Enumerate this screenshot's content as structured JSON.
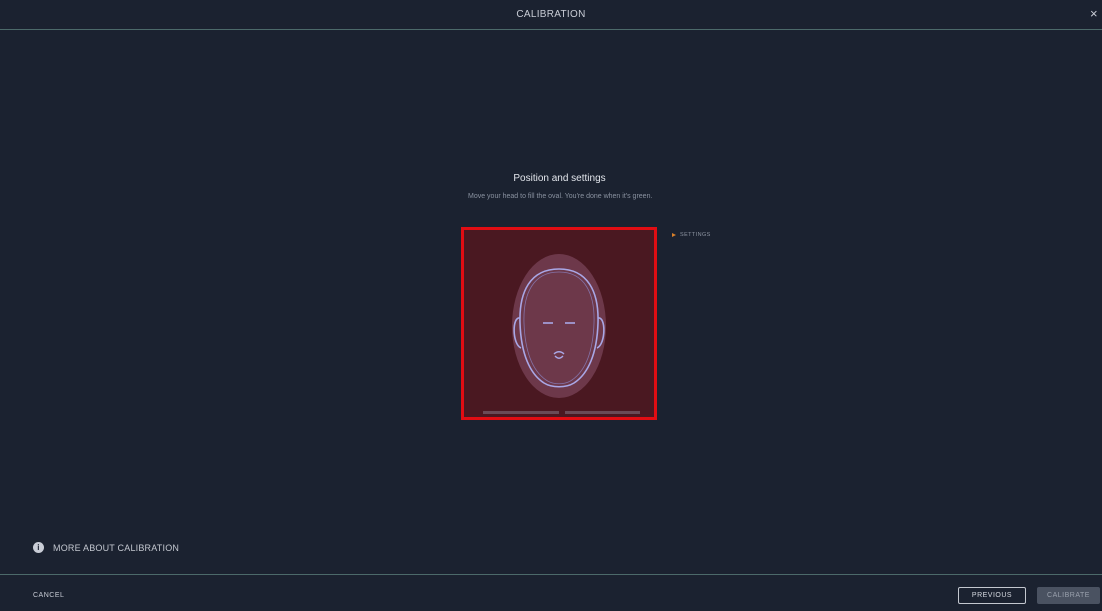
{
  "window": {
    "title": "CALIBRATION",
    "close_glyph": "×"
  },
  "panel": {
    "title": "Position and settings",
    "subtitle": "Move your head to fill the oval. You're done when it's green."
  },
  "settings": {
    "label": "SETTINGS",
    "icon": "caret-right-icon",
    "accent": "#d7802a"
  },
  "camera": {
    "status_color": "#e10d13",
    "icon": "face-outline-icon"
  },
  "help": {
    "label": "MORE ABOUT CALIBRATION",
    "icon": "info-icon",
    "icon_glyph": "i"
  },
  "footer": {
    "cancel_label": "CANCEL",
    "previous_label": "PREVIOUS",
    "calibrate_label": "CALIBRATE"
  }
}
